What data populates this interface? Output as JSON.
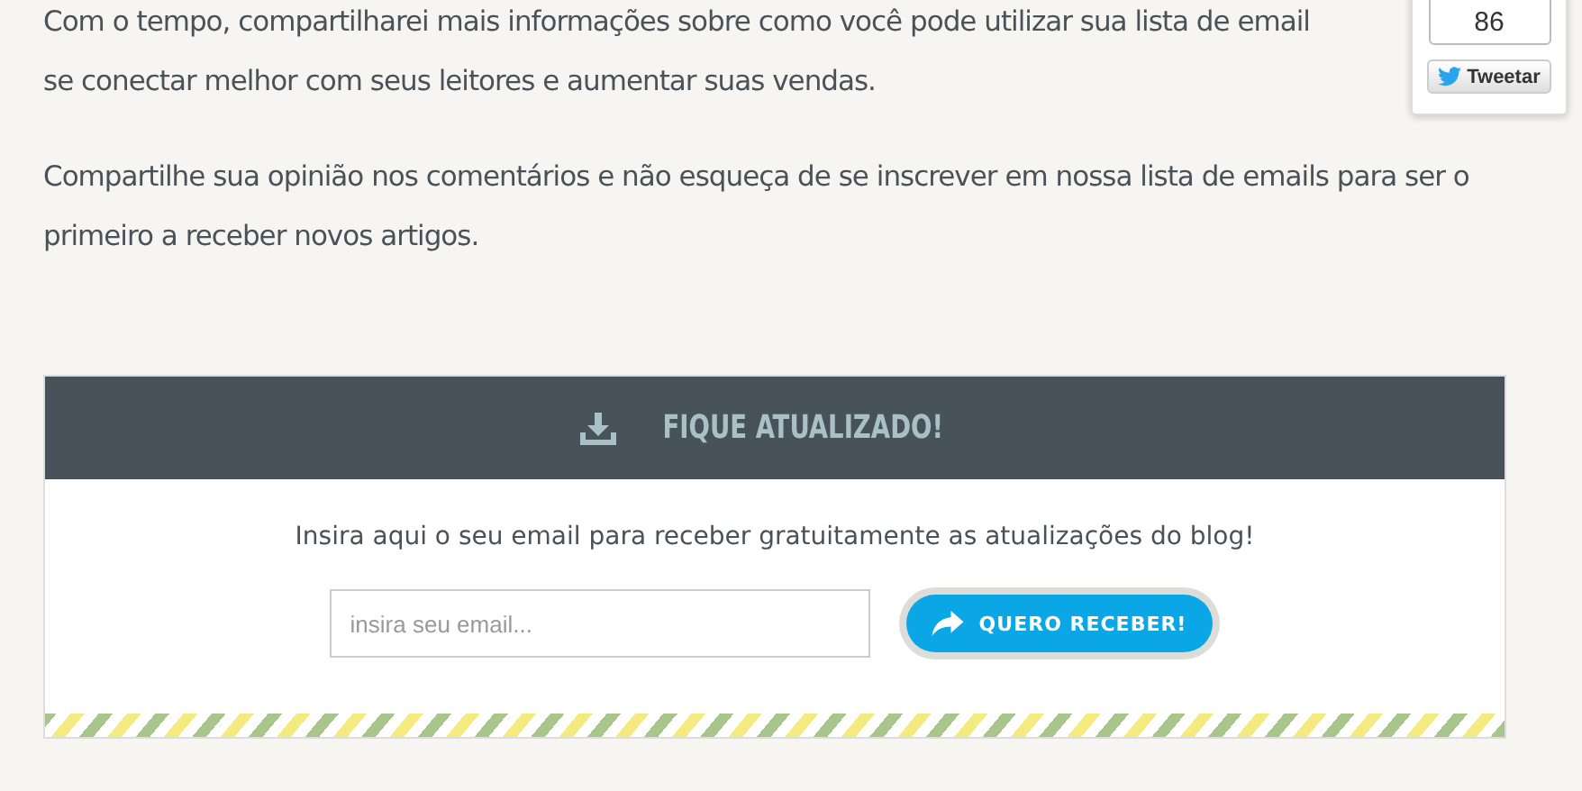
{
  "paragraphs": [
    "Com o tempo, compartilharei mais informações sobre como você pode utilizar sua lista de email\nse conectar melhor com seus leitores e aumentar suas vendas.",
    "Compartilhe sua opinião nos comentários e não esqueça de se inscrever em nossa lista de emails para ser o primeiro a receber novos artigos."
  ],
  "share_widget": {
    "count": "86",
    "button": "Tweetar"
  },
  "subscribe_box": {
    "title": "FIQUE ATUALIZADO!",
    "description": "Insira aqui o seu email para receber gratuitamente as atualizações do blog!",
    "email_field": {
      "placeholder": "insira seu email..."
    },
    "submit_button": "QUERO RECEBER!"
  }
}
